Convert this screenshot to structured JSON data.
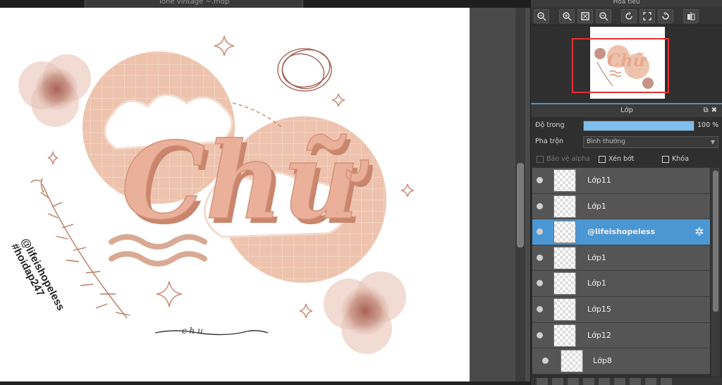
{
  "document": {
    "tab_title": "Tone vintage ~.mdp"
  },
  "artwork": {
    "headline": "Chữ",
    "signature_line": "c h u",
    "credit_handle": "@lifeishopeless",
    "credit_tag": "#hoidap247",
    "colors": {
      "peach": "#e8b9a2",
      "deep_peach": "#d99a80",
      "rose_brown": "#a0574a",
      "blush": "#f3d6c8"
    }
  },
  "navigator": {
    "title": "Hoa tiêu",
    "tools": [
      "zoom-fit-icon",
      "zoom-in-icon",
      "fit-window-icon",
      "zoom-out-icon",
      "rotate-left-icon",
      "fullscreen-icon",
      "rotate-right-icon",
      "flip-icon"
    ]
  },
  "layers_panel": {
    "title": "Lớp",
    "opacity_label": "Độ trong",
    "opacity_value": "100 %",
    "opacity_fraction": 1.0,
    "blend_label": "Pha trộn",
    "blend_value": "Bình thường",
    "protect_alpha": "Bảo vệ alpha",
    "clipping": "Xén bớt",
    "lock": "Khóa",
    "items": [
      {
        "name": "Lớp11",
        "selected": false,
        "indent": false
      },
      {
        "name": "Lớp1",
        "selected": false,
        "indent": false
      },
      {
        "name": "@lifeishopeless",
        "selected": true,
        "indent": false
      },
      {
        "name": "Lớp1",
        "selected": false,
        "indent": false
      },
      {
        "name": "Lớp1",
        "selected": false,
        "indent": false
      },
      {
        "name": "Lớp15",
        "selected": false,
        "indent": false
      },
      {
        "name": "Lớp12",
        "selected": false,
        "indent": false
      },
      {
        "name": "Lớp8",
        "selected": false,
        "indent": true
      }
    ]
  },
  "ui_colors": {
    "selection": "#4b97d4",
    "nav_frame": "#e53030",
    "opacity_fill": "#7fbfef"
  }
}
